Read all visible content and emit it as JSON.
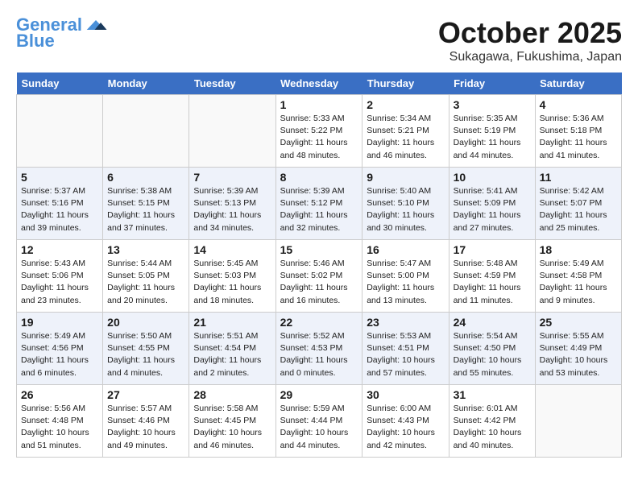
{
  "header": {
    "logo_line1": "General",
    "logo_line2": "Blue",
    "month": "October 2025",
    "location": "Sukagawa, Fukushima, Japan"
  },
  "weekdays": [
    "Sunday",
    "Monday",
    "Tuesday",
    "Wednesday",
    "Thursday",
    "Friday",
    "Saturday"
  ],
  "weeks": [
    [
      {
        "day": "",
        "info": ""
      },
      {
        "day": "",
        "info": ""
      },
      {
        "day": "",
        "info": ""
      },
      {
        "day": "1",
        "info": "Sunrise: 5:33 AM\nSunset: 5:22 PM\nDaylight: 11 hours\nand 48 minutes."
      },
      {
        "day": "2",
        "info": "Sunrise: 5:34 AM\nSunset: 5:21 PM\nDaylight: 11 hours\nand 46 minutes."
      },
      {
        "day": "3",
        "info": "Sunrise: 5:35 AM\nSunset: 5:19 PM\nDaylight: 11 hours\nand 44 minutes."
      },
      {
        "day": "4",
        "info": "Sunrise: 5:36 AM\nSunset: 5:18 PM\nDaylight: 11 hours\nand 41 minutes."
      }
    ],
    [
      {
        "day": "5",
        "info": "Sunrise: 5:37 AM\nSunset: 5:16 PM\nDaylight: 11 hours\nand 39 minutes."
      },
      {
        "day": "6",
        "info": "Sunrise: 5:38 AM\nSunset: 5:15 PM\nDaylight: 11 hours\nand 37 minutes."
      },
      {
        "day": "7",
        "info": "Sunrise: 5:39 AM\nSunset: 5:13 PM\nDaylight: 11 hours\nand 34 minutes."
      },
      {
        "day": "8",
        "info": "Sunrise: 5:39 AM\nSunset: 5:12 PM\nDaylight: 11 hours\nand 32 minutes."
      },
      {
        "day": "9",
        "info": "Sunrise: 5:40 AM\nSunset: 5:10 PM\nDaylight: 11 hours\nand 30 minutes."
      },
      {
        "day": "10",
        "info": "Sunrise: 5:41 AM\nSunset: 5:09 PM\nDaylight: 11 hours\nand 27 minutes."
      },
      {
        "day": "11",
        "info": "Sunrise: 5:42 AM\nSunset: 5:07 PM\nDaylight: 11 hours\nand 25 minutes."
      }
    ],
    [
      {
        "day": "12",
        "info": "Sunrise: 5:43 AM\nSunset: 5:06 PM\nDaylight: 11 hours\nand 23 minutes."
      },
      {
        "day": "13",
        "info": "Sunrise: 5:44 AM\nSunset: 5:05 PM\nDaylight: 11 hours\nand 20 minutes."
      },
      {
        "day": "14",
        "info": "Sunrise: 5:45 AM\nSunset: 5:03 PM\nDaylight: 11 hours\nand 18 minutes."
      },
      {
        "day": "15",
        "info": "Sunrise: 5:46 AM\nSunset: 5:02 PM\nDaylight: 11 hours\nand 16 minutes."
      },
      {
        "day": "16",
        "info": "Sunrise: 5:47 AM\nSunset: 5:00 PM\nDaylight: 11 hours\nand 13 minutes."
      },
      {
        "day": "17",
        "info": "Sunrise: 5:48 AM\nSunset: 4:59 PM\nDaylight: 11 hours\nand 11 minutes."
      },
      {
        "day": "18",
        "info": "Sunrise: 5:49 AM\nSunset: 4:58 PM\nDaylight: 11 hours\nand 9 minutes."
      }
    ],
    [
      {
        "day": "19",
        "info": "Sunrise: 5:49 AM\nSunset: 4:56 PM\nDaylight: 11 hours\nand 6 minutes."
      },
      {
        "day": "20",
        "info": "Sunrise: 5:50 AM\nSunset: 4:55 PM\nDaylight: 11 hours\nand 4 minutes."
      },
      {
        "day": "21",
        "info": "Sunrise: 5:51 AM\nSunset: 4:54 PM\nDaylight: 11 hours\nand 2 minutes."
      },
      {
        "day": "22",
        "info": "Sunrise: 5:52 AM\nSunset: 4:53 PM\nDaylight: 11 hours\nand 0 minutes."
      },
      {
        "day": "23",
        "info": "Sunrise: 5:53 AM\nSunset: 4:51 PM\nDaylight: 10 hours\nand 57 minutes."
      },
      {
        "day": "24",
        "info": "Sunrise: 5:54 AM\nSunset: 4:50 PM\nDaylight: 10 hours\nand 55 minutes."
      },
      {
        "day": "25",
        "info": "Sunrise: 5:55 AM\nSunset: 4:49 PM\nDaylight: 10 hours\nand 53 minutes."
      }
    ],
    [
      {
        "day": "26",
        "info": "Sunrise: 5:56 AM\nSunset: 4:48 PM\nDaylight: 10 hours\nand 51 minutes."
      },
      {
        "day": "27",
        "info": "Sunrise: 5:57 AM\nSunset: 4:46 PM\nDaylight: 10 hours\nand 49 minutes."
      },
      {
        "day": "28",
        "info": "Sunrise: 5:58 AM\nSunset: 4:45 PM\nDaylight: 10 hours\nand 46 minutes."
      },
      {
        "day": "29",
        "info": "Sunrise: 5:59 AM\nSunset: 4:44 PM\nDaylight: 10 hours\nand 44 minutes."
      },
      {
        "day": "30",
        "info": "Sunrise: 6:00 AM\nSunset: 4:43 PM\nDaylight: 10 hours\nand 42 minutes."
      },
      {
        "day": "31",
        "info": "Sunrise: 6:01 AM\nSunset: 4:42 PM\nDaylight: 10 hours\nand 40 minutes."
      },
      {
        "day": "",
        "info": ""
      }
    ]
  ]
}
